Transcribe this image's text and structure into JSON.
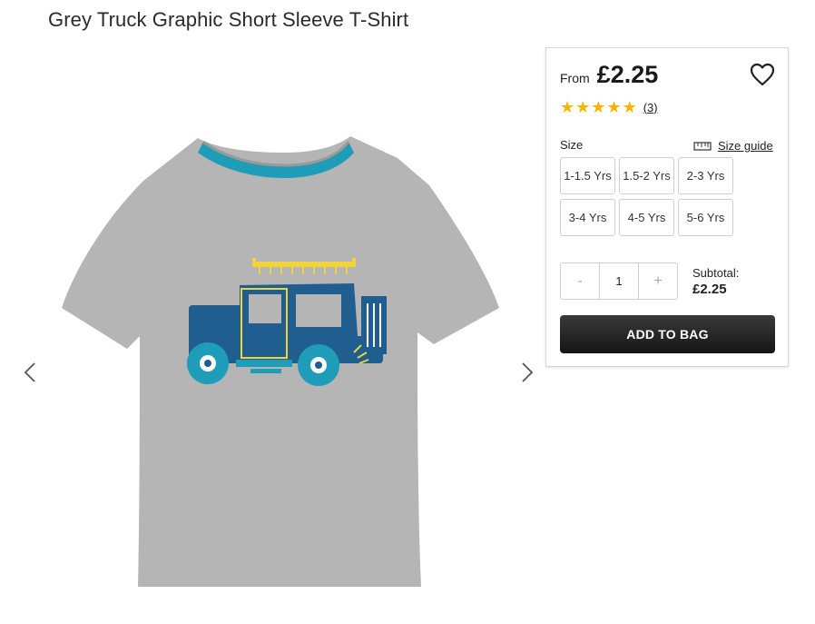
{
  "product": {
    "title": "Grey Truck Graphic Short Sleeve T-Shirt"
  },
  "carousel": {
    "prev_icon": "chevron-left-icon",
    "next_icon": "chevron-right-icon",
    "image_alt": "Grey t-shirt with blue truck graphic"
  },
  "purchase": {
    "from_label": "From",
    "price": "£2.25",
    "wishlist_icon": "heart-icon",
    "rating": {
      "stars": 5,
      "max": 5,
      "count_label": "(3)"
    },
    "size_label": "Size",
    "size_guide_label": "Size guide",
    "size_guide_icon": "ruler-icon",
    "sizes": [
      "1-1.5 Yrs",
      "1.5-2 Yrs",
      "2-3 Yrs",
      "3-4 Yrs",
      "4-5 Yrs",
      "5-6 Yrs"
    ],
    "quantity": {
      "minus": "-",
      "value": "1",
      "plus": "+"
    },
    "subtotal_label": "Subtotal:",
    "subtotal_value": "£2.25",
    "add_to_bag_label": "ADD TO BAG"
  },
  "colors": {
    "star": "#f5b400",
    "button_bg": "#1a1a1a",
    "tshirt": "#b3b3b3",
    "collar_trim": "#1e9cb8",
    "truck_blue": "#1f5e8e",
    "truck_yellow": "#f1d33b"
  }
}
